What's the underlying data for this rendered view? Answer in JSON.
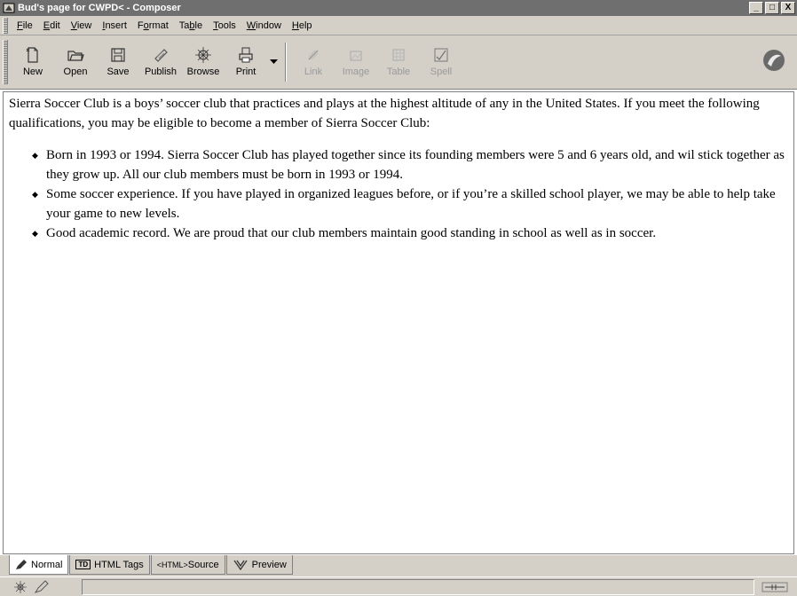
{
  "window": {
    "title": "Bud's page for CWPD< - Composer",
    "controls": {
      "minimize": "_",
      "maximize": "□",
      "close": "X"
    }
  },
  "menubar": {
    "items": [
      {
        "pre": "",
        "key": "F",
        "post": "ile"
      },
      {
        "pre": "",
        "key": "E",
        "post": "dit"
      },
      {
        "pre": "",
        "key": "V",
        "post": "iew"
      },
      {
        "pre": "",
        "key": "I",
        "post": "nsert"
      },
      {
        "pre": "F",
        "key": "o",
        "post": "rmat"
      },
      {
        "pre": "Ta",
        "key": "b",
        "post": "le"
      },
      {
        "pre": "",
        "key": "T",
        "post": "ools"
      },
      {
        "pre": "",
        "key": "W",
        "post": "indow"
      },
      {
        "pre": "",
        "key": "H",
        "post": "elp"
      }
    ]
  },
  "toolbar": {
    "buttons": [
      {
        "label": "New",
        "icon": "new-page-icon",
        "enabled": true
      },
      {
        "label": "Open",
        "icon": "open-folder-icon",
        "enabled": true
      },
      {
        "label": "Save",
        "icon": "floppy-disk-icon",
        "enabled": true
      },
      {
        "label": "Publish",
        "icon": "publish-icon",
        "enabled": true
      },
      {
        "label": "Browse",
        "icon": "browse-globe-icon",
        "enabled": true
      },
      {
        "label": "Print",
        "icon": "printer-icon",
        "enabled": true
      },
      {
        "label": "Link",
        "icon": "link-icon",
        "enabled": false
      },
      {
        "label": "Image",
        "icon": "image-icon",
        "enabled": false
      },
      {
        "label": "Table",
        "icon": "table-icon",
        "enabled": false
      },
      {
        "label": "Spell",
        "icon": "spell-check-icon",
        "enabled": false
      }
    ]
  },
  "document": {
    "intro": "Sierra Soccer Club is a boys’ soccer club that practices and plays at the highest altitude of any in the United States. If you meet the following qualifications, you may be eligible to become a member of Sierra Soccer Club:",
    "bullets": [
      "Born in 1993 or 1994. Sierra Soccer Club has played together since its founding members were 5 and 6 years old, and wil stick together as they grow up. All our club members must be born in 1993 or 1994.",
      "Some soccer experience. If you have played in organized leagues before, or if you’re a skilled school player, we may be able to help take your game to new levels.",
      "Good academic record. We are proud that our club members maintain good standing in school as well as in soccer."
    ]
  },
  "edit_mode_tabs": [
    {
      "label": "Normal",
      "icon": "pencil-icon",
      "active": true
    },
    {
      "label": "HTML Tags",
      "icon": "tag-icon",
      "active": false
    },
    {
      "label": "Source",
      "prefix": "<HTML>",
      "active": false
    },
    {
      "label": "Preview",
      "icon": "preview-icon",
      "active": false
    }
  ]
}
